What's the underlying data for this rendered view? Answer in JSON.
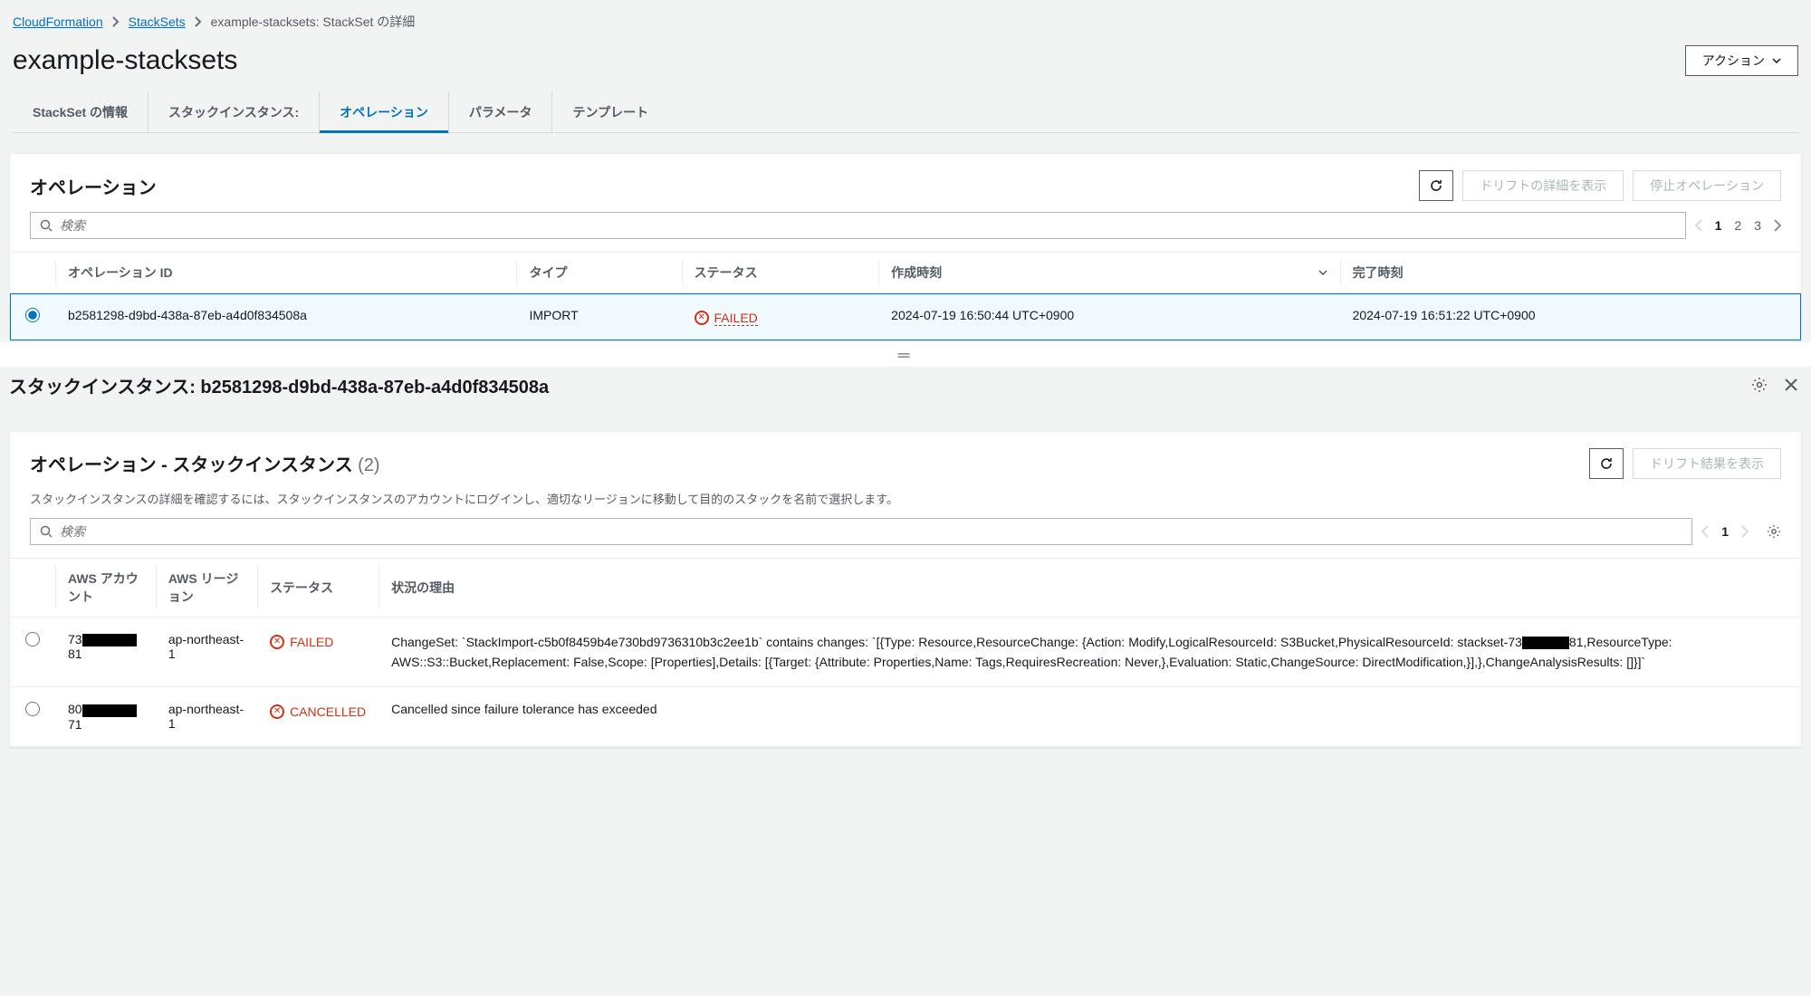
{
  "breadcrumb": {
    "root": "CloudFormation",
    "stacksets": "StackSets",
    "current": "example-stacksets: StackSet の詳細"
  },
  "page": {
    "title": "example-stacksets",
    "actions_label": "アクション"
  },
  "tabs": {
    "info": "StackSet の情報",
    "instances": "スタックインスタンス:",
    "operations": "オペレーション",
    "parameters": "パラメータ",
    "template": "テンプレート"
  },
  "operations_panel": {
    "title": "オペレーション",
    "drift_btn": "ドリフトの詳細を表示",
    "stop_btn": "停止オペレーション",
    "search_placeholder": "検索",
    "pages": [
      "1",
      "2",
      "3"
    ],
    "columns": {
      "op_id": "オペレーション ID",
      "type": "タイプ",
      "status": "ステータス",
      "created": "作成時刻",
      "finished": "完了時刻"
    },
    "rows": [
      {
        "selected": true,
        "op_id": "b2581298-d9bd-438a-87eb-a4d0f834508a",
        "type": "IMPORT",
        "status": "FAILED",
        "created": "2024-07-19 16:50:44 UTC+0900",
        "finished": "2024-07-19 16:51:22 UTC+0900"
      }
    ]
  },
  "detail": {
    "title": "スタックインスタンス: b2581298-d9bd-438a-87eb-a4d0f834508a"
  },
  "instances_panel": {
    "title": "オペレーション - スタックインスタンス",
    "count": "(2)",
    "subtitle": "スタックインスタンスの詳細を確認するには、スタックインスタンスのアカウントにログインし、適切なリージョンに移動して目的のスタックを名前で選択します。",
    "drift_btn": "ドリフト結果を表示",
    "search_placeholder": "検索",
    "page": "1",
    "columns": {
      "account": "AWS アカウント",
      "region": "AWS リージョン",
      "status": "ステータス",
      "reason": "状況の理由"
    },
    "rows": [
      {
        "acct_prefix": "73",
        "acct_suffix": "81",
        "region": "ap-northeast-1",
        "status": "FAILED",
        "reason_pre": "ChangeSet: `StackImport-c5b0f8459b4e730bd9736310b3c2ee1b` contains changes: `[{Type: Resource,ResourceChange: {Action: Modify,LogicalResourceId: S3Bucket,PhysicalResourceId: stackset-73",
        "reason_post": "81,ResourceType: AWS::S3::Bucket,Replacement: False,Scope: [Properties],Details: [{Target: {Attribute: Properties,Name: Tags,RequiresRecreation: Never,},Evaluation: Static,ChangeSource: DirectModification,}],},ChangeAnalysisResults: []}]`"
      },
      {
        "acct_prefix": "80",
        "acct_suffix": "71",
        "region": "ap-northeast-1",
        "status": "CANCELLED",
        "reason": "Cancelled since failure tolerance has exceeded"
      }
    ]
  }
}
